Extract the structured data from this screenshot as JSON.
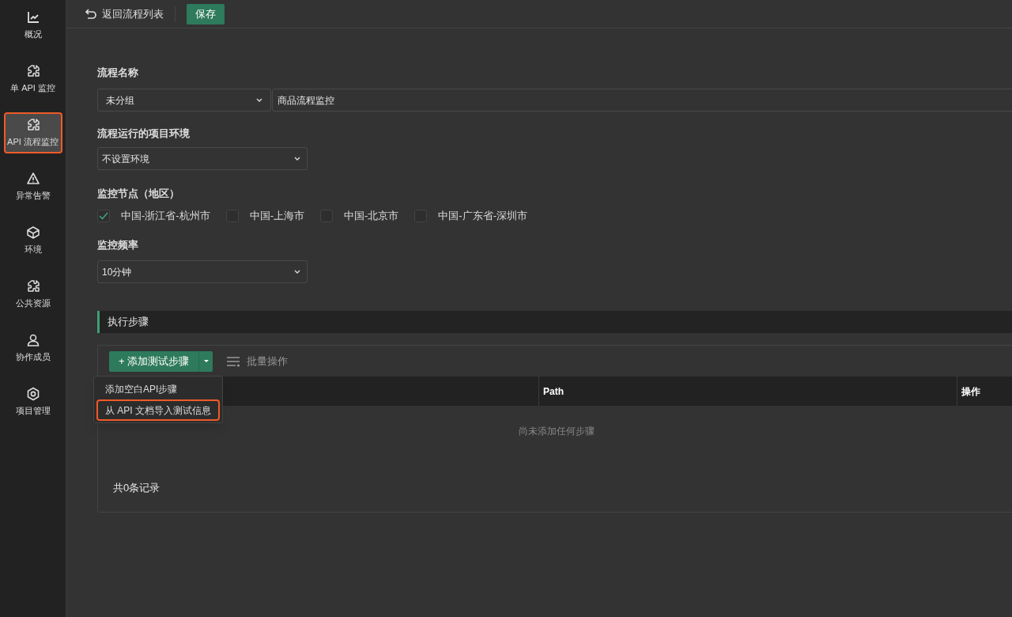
{
  "sidebar": {
    "items": [
      {
        "kind": "chart",
        "label": "概况",
        "selected": false,
        "highlighted": false
      },
      {
        "kind": "puzzle",
        "label": "单 API 监控",
        "selected": false,
        "highlighted": false
      },
      {
        "kind": "puzzle",
        "label": "API 流程监控",
        "selected": true,
        "highlighted": true
      },
      {
        "kind": "warning",
        "label": "异常告警",
        "selected": false,
        "highlighted": false
      },
      {
        "kind": "cube",
        "label": "环境",
        "selected": false,
        "highlighted": false
      },
      {
        "kind": "puzzle",
        "label": "公共资源",
        "selected": false,
        "highlighted": false
      },
      {
        "kind": "user",
        "label": "协作成员",
        "selected": false,
        "highlighted": false
      },
      {
        "kind": "gear",
        "label": "项目管理",
        "selected": false,
        "highlighted": false
      }
    ]
  },
  "toolbar": {
    "back": "返回流程列表",
    "save": "保存"
  },
  "form": {
    "name_label": "流程名称",
    "group": "未分组",
    "name": "商品流程监控",
    "env_label": "流程运行的项目环境",
    "env": "不设置环境",
    "nodes_label": "监控节点（地区）",
    "nodes": [
      {
        "label": "中国-浙江省-杭州市",
        "checked": true
      },
      {
        "label": "中国-上海市",
        "checked": false
      },
      {
        "label": "中国-北京市",
        "checked": false
      },
      {
        "label": "中国-广东省-深圳市",
        "checked": false
      }
    ],
    "freq_label": "监控频率",
    "freq": "10分钟"
  },
  "steps": {
    "title": "执行步骤",
    "add_button": "+ 添加测试步骤",
    "batch": "批量操作",
    "menu": [
      {
        "label": "添加空白API步骤",
        "highlighted": false
      },
      {
        "label": "从 API 文档导入测试信息",
        "highlighted": true
      }
    ],
    "columns": [
      "Path",
      "操作"
    ],
    "empty": "尚未添加任何步骤",
    "total": "共0条记录"
  }
}
